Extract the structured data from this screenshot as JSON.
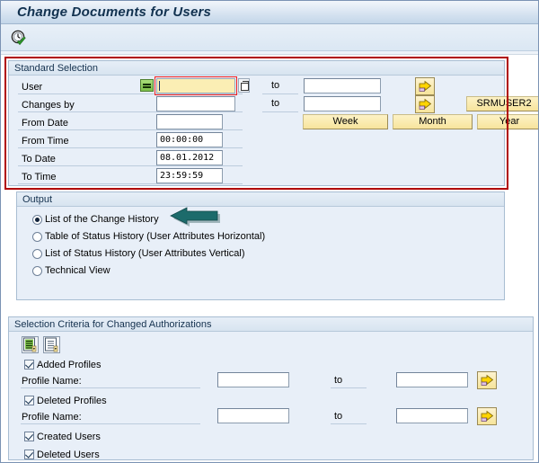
{
  "window": {
    "title": "Change Documents for Users"
  },
  "toolbar": {
    "execute_label": "Execute",
    "execute_icon": "clock-check-icon"
  },
  "standard_selection": {
    "title": "Standard Selection",
    "rows": [
      {
        "label": "User",
        "value": "",
        "to_label": "to",
        "to_value": ""
      },
      {
        "label": "Changes by",
        "value": "",
        "to_label": "to",
        "to_value": ""
      },
      {
        "label": "From Date",
        "value": ""
      },
      {
        "label": "From Time",
        "value": "00:00:00"
      },
      {
        "label": "To Date",
        "value": "08.01.2012"
      },
      {
        "label": "To Time",
        "value": "23:59:59"
      }
    ],
    "buttons": {
      "week": "Week",
      "month": "Month",
      "year": "Year",
      "user_shortcut": "SRMUSER2"
    },
    "icons": {
      "multi_select": "equals-icon",
      "value_help": "matchcode-icon",
      "multiple_selection": "yellow-arrow-icon"
    },
    "highlight_color": "#b00000"
  },
  "output": {
    "title": "Output",
    "options": [
      {
        "label": "List of the Change History",
        "selected": true
      },
      {
        "label": "Table of Status History (User Attributes Horizontal)",
        "selected": false
      },
      {
        "label": "List of Status History (User Attributes Vertical)",
        "selected": false
      },
      {
        "label": "Technical View",
        "selected": false
      }
    ],
    "annotation": {
      "type": "arrow-left",
      "color": "#1f6b6b",
      "points_to": "List of the Change History"
    }
  },
  "criteria": {
    "title": "Selection Criteria for Changed Authorizations",
    "toolbar_icons": [
      "select-all-icon",
      "deselect-all-icon"
    ],
    "items": [
      {
        "kind": "checkbox",
        "label": "Added Profiles",
        "checked": true
      },
      {
        "kind": "field",
        "label": "Profile Name:",
        "value": "",
        "to_label": "to",
        "to_value": ""
      },
      {
        "kind": "checkbox",
        "label": "Deleted Profiles",
        "checked": true
      },
      {
        "kind": "field",
        "label": "Profile Name:",
        "value": "",
        "to_label": "to",
        "to_value": ""
      },
      {
        "kind": "checkbox",
        "label": "Created Users",
        "checked": true
      },
      {
        "kind": "checkbox",
        "label": "Deleted Users",
        "checked": true
      }
    ]
  },
  "colors": {
    "title_bar": "#c3d6e9",
    "group_bg": "#e8eff8",
    "accent_yellow": "#f7e49c",
    "focus_field": "#fbeeb4",
    "highlight": "#b00000"
  }
}
